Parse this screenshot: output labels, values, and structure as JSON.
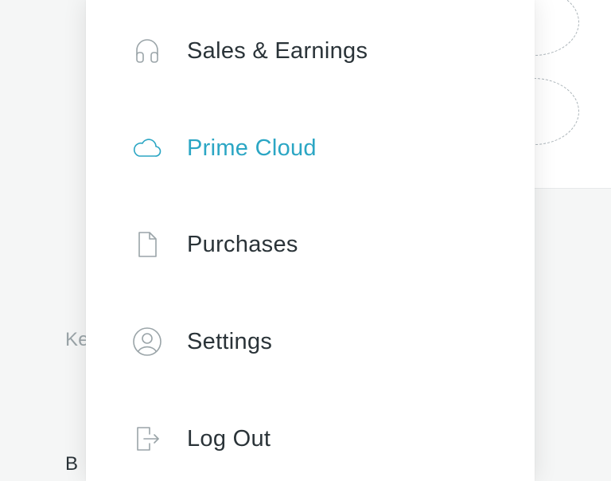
{
  "background": {
    "left_partial_text": "Ke",
    "left_partial_letter": "B"
  },
  "menu": {
    "items": [
      {
        "id": "sales",
        "label": "Sales & Earnings",
        "icon": "headphones-icon",
        "active": false
      },
      {
        "id": "cloud",
        "label": "Prime Cloud",
        "icon": "cloud-icon",
        "active": true
      },
      {
        "id": "purchases",
        "label": "Purchases",
        "icon": "document-icon",
        "active": false
      },
      {
        "id": "settings",
        "label": "Settings",
        "icon": "user-circle-icon",
        "active": false
      },
      {
        "id": "logout",
        "label": "Log Out",
        "icon": "logout-icon",
        "active": false
      }
    ]
  },
  "colors": {
    "accent": "#2ba6c4",
    "text": "#2a3338",
    "icon_muted": "#9aa4a8"
  }
}
